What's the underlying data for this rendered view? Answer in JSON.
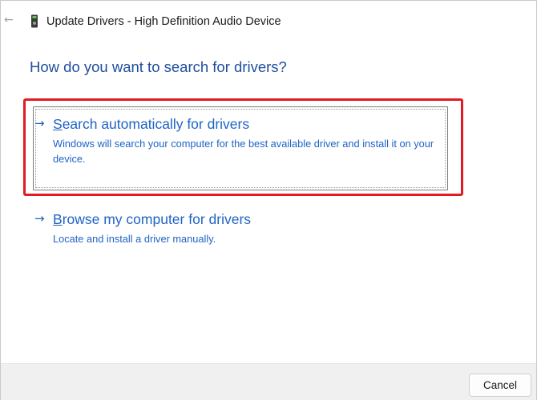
{
  "window": {
    "title": "Update Drivers - High Definition Audio Device",
    "back_icon": "back-arrow-icon",
    "device_icon": "audio-device-icon"
  },
  "main": {
    "heading": "How do you want to search for drivers?",
    "options": [
      {
        "arrow": "→",
        "title_first": "S",
        "title_rest": "earch automatically for drivers",
        "description": "Windows will search your computer for the best available driver and install it on your device.",
        "highlighted": true
      },
      {
        "arrow": "→",
        "title_first": "B",
        "title_rest": "rowse my computer for drivers",
        "description": "Locate and install a driver manually.",
        "highlighted": false
      }
    ]
  },
  "footer": {
    "cancel_label": "Cancel"
  },
  "colors": {
    "link": "#1f63c6",
    "heading": "#1f4e9e",
    "highlight": "#e01b22",
    "footer_bg": "#f0f0f0"
  }
}
